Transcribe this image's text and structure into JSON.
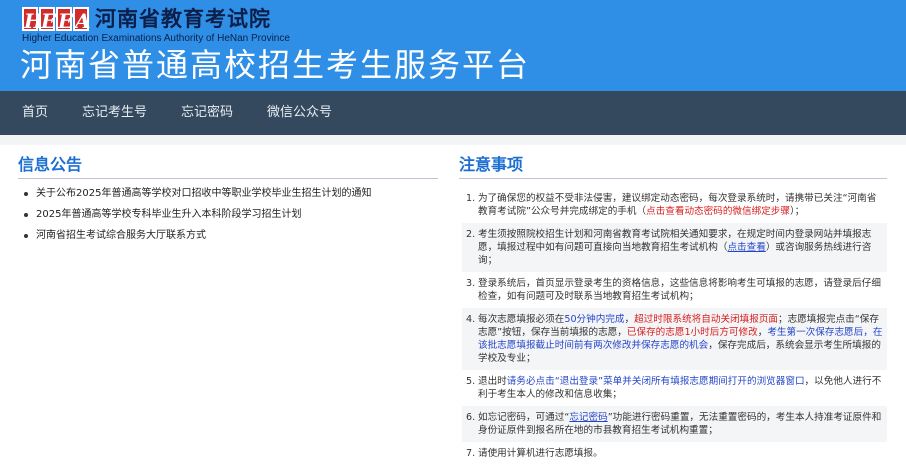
{
  "header": {
    "logo_letters": [
      "H",
      "E",
      "E",
      "A"
    ],
    "org_name": "河南省教育考试院",
    "org_name_en": "Higher Education Examinations Authority of HeNan Province",
    "platform_title": "河南省普通高校招生考生服务平台"
  },
  "nav": {
    "items": [
      "首页",
      "忘记考生号",
      "忘记密码",
      "微信公众号"
    ]
  },
  "announcements": {
    "title": "信息公告",
    "items": [
      "关于公布2025年普通高等学校对口招收中等职业学校毕业生招生计划的通知",
      "2025年普通高等学校专科毕业生升入本科阶段学习招生计划",
      "河南省招生考试综合服务大厅联系方式"
    ]
  },
  "notes": {
    "title": "注意事项",
    "items": [
      {
        "num": "1.",
        "parts": [
          {
            "t": "为了确保您的权益不受非法侵害，建议绑定动态密码，每次登录系统时，请携带已关注“河南省教育考试院”公众号并完成绑定的手机（"
          },
          {
            "t": "点击查看动态密码的微信绑定步骤",
            "s": "red"
          },
          {
            "t": "）；"
          }
        ]
      },
      {
        "num": "2.",
        "parts": [
          {
            "t": "考生须按照院校招生计划和河南省教育考试院相关通知要求，在规定时间内登录网站并填报志愿，填报过程中如有问题可直接向当地教育招生考试机构（"
          },
          {
            "t": "点击查看",
            "s": "link"
          },
          {
            "t": "）或咨询服务热线进行咨询；"
          }
        ]
      },
      {
        "num": "3.",
        "parts": [
          {
            "t": "登录系统后，首页显示登录考生的资格信息，这些信息将影响考生可填报的志愿，请登录后仔细检查，如有问题可及时联系当地教育招生考试机构；"
          }
        ]
      },
      {
        "num": "4.",
        "parts": [
          {
            "t": "每次志愿填报必须在"
          },
          {
            "t": "50分钟内完成",
            "s": "blue"
          },
          {
            "t": "，"
          },
          {
            "t": "超过时限系统将自动关闭填报页面",
            "s": "red"
          },
          {
            "t": "；志愿填报完点击“保存志愿”按钮，保存当前填报的志愿，"
          },
          {
            "t": "已保存的志愿1小时后方可修改",
            "s": "red"
          },
          {
            "t": "，"
          },
          {
            "t": "考生第一次保存志愿后，在该批志愿填报截止时间前有两次修改并保存志愿的机会",
            "s": "blue"
          },
          {
            "t": "，保存完成后，系统会显示考生所填报的学校及专业；"
          }
        ]
      },
      {
        "num": "5.",
        "parts": [
          {
            "t": "退出时"
          },
          {
            "t": "请务必点击“退出登录”菜单并关闭所有填报志愿期间打开的浏览器窗口",
            "s": "blue"
          },
          {
            "t": "，以免他人进行不利于考生本人的修改和信息收集；"
          }
        ]
      },
      {
        "num": "6.",
        "parts": [
          {
            "t": "如忘记密码，可通过“"
          },
          {
            "t": "忘记密码",
            "s": "link"
          },
          {
            "t": "”功能进行密码重置，无法重置密码的，考生本人持准考证原件和身份证原件到报名所在地的市县教育招生考试机构重置；"
          }
        ]
      },
      {
        "num": "7.",
        "parts": [
          {
            "t": "请使用计算机进行志愿填报。"
          }
        ]
      }
    ]
  }
}
